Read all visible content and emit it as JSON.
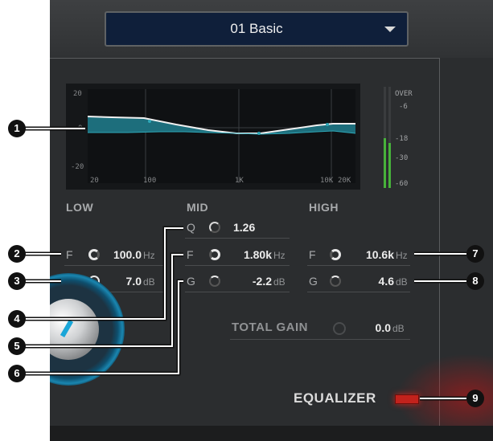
{
  "preset": {
    "name": "01 Basic"
  },
  "graph": {
    "y_labels": [
      "20",
      "0",
      "-20"
    ],
    "x_labels": [
      "20",
      "100",
      "1K",
      "10K",
      "20K"
    ]
  },
  "meter": {
    "labels": [
      "OVER",
      "-6",
      "-18",
      "-30",
      "-60"
    ]
  },
  "bands": {
    "low": {
      "title": "LOW",
      "f": {
        "label": "F",
        "value": "100.0",
        "unit": "Hz"
      },
      "g": {
        "label": "G",
        "value": "7.0",
        "unit": "dB"
      }
    },
    "mid": {
      "title": "MID",
      "q": {
        "label": "Q",
        "value": "1.26"
      },
      "f": {
        "label": "F",
        "value": "1.80k",
        "unit": "Hz"
      },
      "g": {
        "label": "G",
        "value": "-2.2",
        "unit": "dB"
      }
    },
    "high": {
      "title": "HIGH",
      "f": {
        "label": "F",
        "value": "10.6k",
        "unit": "Hz"
      },
      "g": {
        "label": "G",
        "value": "4.6",
        "unit": "dB"
      }
    }
  },
  "total_gain": {
    "label": "TOTAL GAIN",
    "value": "0.0",
    "unit": "dB"
  },
  "equalizer": {
    "label": "EQUALIZER"
  },
  "callouts": [
    "1",
    "2",
    "3",
    "4",
    "5",
    "6",
    "7",
    "8",
    "9"
  ]
}
